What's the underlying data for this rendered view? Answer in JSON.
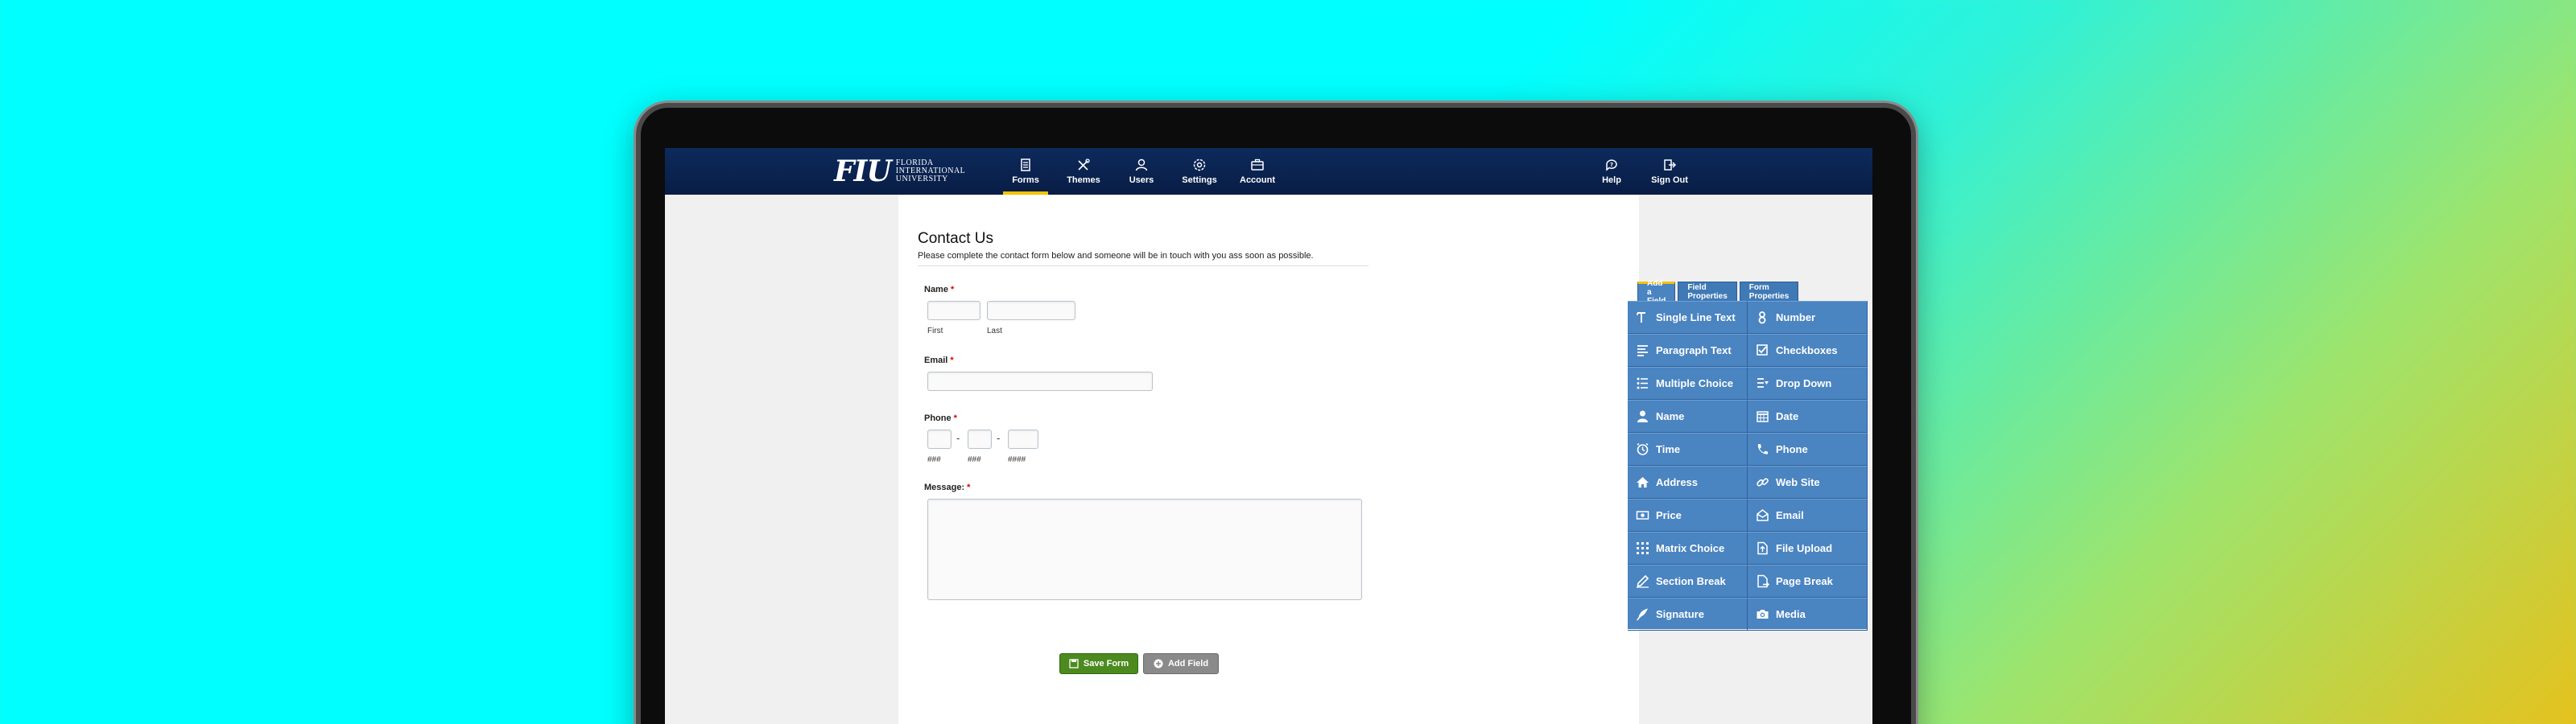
{
  "header": {
    "logo_mark": "FIU",
    "logo_lines": [
      "FLORIDA",
      "INTERNATIONAL",
      "UNIVERSITY"
    ],
    "nav": [
      {
        "label": "Forms",
        "icon": "forms-icon",
        "active": true
      },
      {
        "label": "Themes",
        "icon": "themes-icon"
      },
      {
        "label": "Users",
        "icon": "users-icon"
      },
      {
        "label": "Settings",
        "icon": "settings-icon"
      },
      {
        "label": "Account",
        "icon": "account-icon"
      }
    ],
    "right_nav": [
      {
        "label": "Help",
        "icon": "help-icon"
      },
      {
        "label": "Sign Out",
        "icon": "sign-out-icon"
      }
    ]
  },
  "form": {
    "title": "Contact Us",
    "description": "Please complete the contact form below and someone will be in touch with you ass soon as possible.",
    "name_label": "Name",
    "name_first": "First",
    "name_last": "Last",
    "email_label": "Email",
    "phone_label": "Phone",
    "phone_sub": [
      "###",
      "###",
      "####"
    ],
    "message_label": "Message:",
    "required_mark": "*",
    "save_label": "Save Form",
    "add_label": "Add Field"
  },
  "panel": {
    "tabs": [
      "Add a Field",
      "Field Properties",
      "Form Properties"
    ],
    "fields": [
      {
        "label": "Single Line Text",
        "icon": "text-icon"
      },
      {
        "label": "Number",
        "icon": "number-icon"
      },
      {
        "label": "Paragraph Text",
        "icon": "paragraph-icon"
      },
      {
        "label": "Checkboxes",
        "icon": "checkbox-icon"
      },
      {
        "label": "Multiple Choice",
        "icon": "list-icon"
      },
      {
        "label": "Drop Down",
        "icon": "dropdown-icon"
      },
      {
        "label": "Name",
        "icon": "person-icon"
      },
      {
        "label": "Date",
        "icon": "calendar-icon"
      },
      {
        "label": "Time",
        "icon": "clock-icon"
      },
      {
        "label": "Phone",
        "icon": "phone-icon"
      },
      {
        "label": "Address",
        "icon": "home-icon"
      },
      {
        "label": "Web Site",
        "icon": "link-icon"
      },
      {
        "label": "Price",
        "icon": "price-icon"
      },
      {
        "label": "Email",
        "icon": "email-icon"
      },
      {
        "label": "Matrix Choice",
        "icon": "grid-icon"
      },
      {
        "label": "File Upload",
        "icon": "upload-icon"
      },
      {
        "label": "Section Break",
        "icon": "pencil-icon"
      },
      {
        "label": "Page Break",
        "icon": "page-icon"
      },
      {
        "label": "Signature",
        "icon": "feather-icon"
      },
      {
        "label": "Media",
        "icon": "camera-icon"
      }
    ]
  },
  "colors": {
    "header": "#0d2a5c",
    "accent": "#f2c300",
    "panel": "#4a84c1",
    "save_button": "#4c8a1f"
  }
}
